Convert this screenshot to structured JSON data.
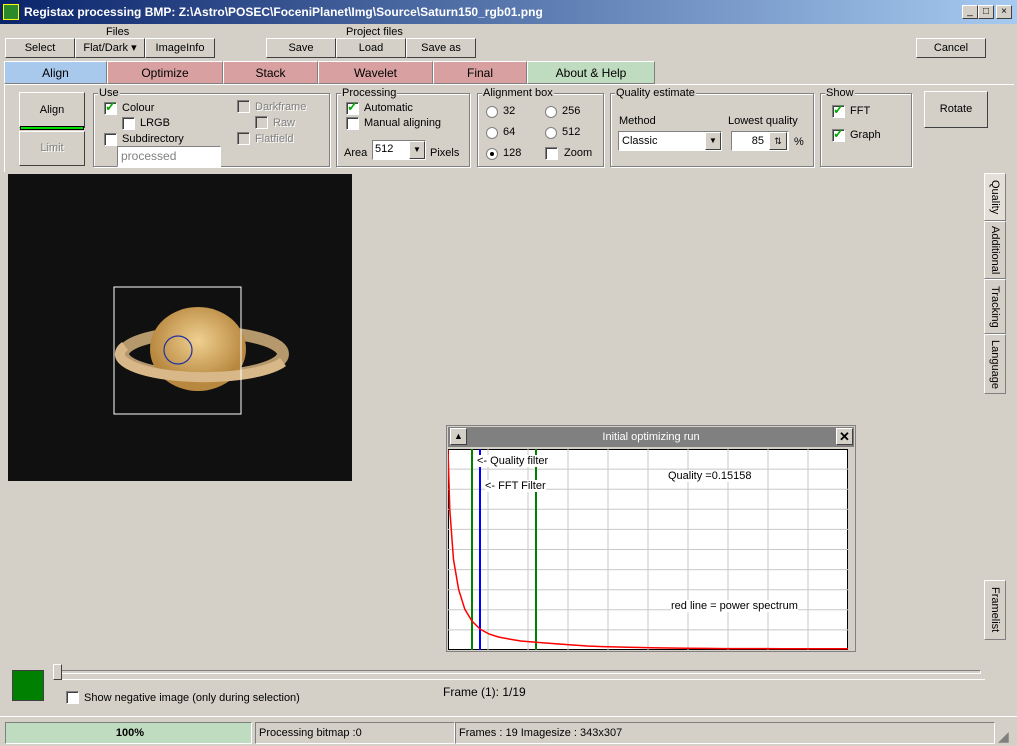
{
  "window": {
    "title": "Registax processing BMP: Z:\\Astro\\POSEC\\FoceniPlanet\\Img\\Source\\Saturn150_rgb01.png",
    "minimize": "_",
    "maximize": "□",
    "close": "×"
  },
  "files": {
    "label": "Files",
    "select": "Select",
    "flatdark": "Flat/Dark ▾",
    "imageinfo": "ImageInfo"
  },
  "project": {
    "label": "Project files",
    "save": "Save",
    "load": "Load",
    "saveas": "Save as"
  },
  "cancel": "Cancel",
  "tabs": [
    {
      "label": "Align",
      "color": "#a8c8ec"
    },
    {
      "label": "Optimize",
      "color": "#d8a0a0"
    },
    {
      "label": "Stack",
      "color": "#d8a0a0"
    },
    {
      "label": "Wavelet",
      "color": "#d8a0a0"
    },
    {
      "label": "Final",
      "color": "#d8a0a0"
    },
    {
      "label": "About & Help",
      "color": "#c0dcc0"
    }
  ],
  "align_btn": "Align",
  "limit_btn": "Limit",
  "use": {
    "title": "Use",
    "colour": "Colour",
    "lrgb": "LRGB",
    "subdirectory": "Subdirectory",
    "subdir_value": "processed",
    "darkframe": "Darkframe",
    "raw": "Raw",
    "flatfield": "Flatfield"
  },
  "processing": {
    "title": "Processing",
    "automatic": "Automatic",
    "manual": "Manual aligning",
    "area_label": "Area",
    "area_value": "512",
    "pixels": "Pixels"
  },
  "alignbox": {
    "title": "Alignment box",
    "options": [
      "32",
      "256",
      "64",
      "512",
      "128"
    ],
    "selected": "128",
    "zoom": "Zoom"
  },
  "quality": {
    "title": "Quality estimate",
    "method_label": "Method",
    "method_value": "Classic",
    "lowest_label": "Lowest quality",
    "lowest_value": "85",
    "percent": "%"
  },
  "show": {
    "title": "Show",
    "fft": "FFT",
    "graph": "Graph"
  },
  "rotate": "Rotate",
  "side_tabs": [
    "Quality",
    "Additional",
    "Tracking",
    "Language",
    "Framelist"
  ],
  "graph": {
    "title": "Initial optimizing run",
    "quality_filter": "<- Quality filter",
    "fft_filter": "<- FFT Filter",
    "quality_text": "Quality =0.15158",
    "legend": "red line = power spectrum"
  },
  "chart_data": {
    "type": "line",
    "grid": true,
    "series": [
      {
        "name": "red line = power spectrum",
        "color": "#ff0000",
        "values": [
          1.0,
          0.7,
          0.45,
          0.3,
          0.2,
          0.14,
          0.1,
          0.075,
          0.06,
          0.05,
          0.04,
          0.035,
          0.03,
          0.025,
          0.02,
          0.015,
          0.012,
          0.01,
          0.008,
          0.006,
          0.005,
          0.004,
          0.003,
          0.002,
          0.002,
          0.002,
          0.001,
          0.001,
          0.001,
          0.001
        ]
      }
    ],
    "markers": [
      {
        "label": "Quality filter",
        "color": "#008000",
        "position": 0.06
      },
      {
        "label": "FFT Filter",
        "color": "#0000ff",
        "position": 0.08
      },
      {
        "color": "#008000",
        "position": 0.22
      }
    ]
  },
  "negative": "Show negative image (only during selection)",
  "frame_text": "Frame (1): 1/19",
  "status": {
    "progress": "100%",
    "progress_value": 100,
    "processing": "Processing bitmap :0",
    "frames": "Frames : 19 Imagesize : 343x307"
  }
}
